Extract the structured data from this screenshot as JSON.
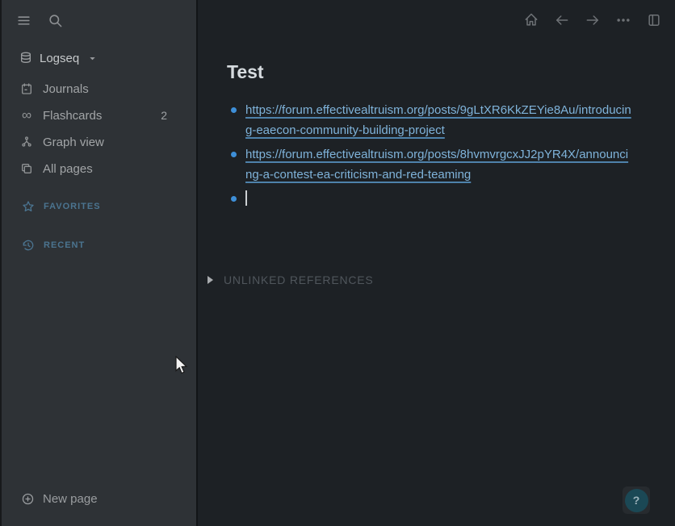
{
  "colors": {
    "main_bg": "#1d2125",
    "sidebar_bg": "#2e3236",
    "link": "#7fb3da",
    "bullet": "#3e8fd8",
    "section_accent": "#4b7490",
    "title": "#d6dbdf",
    "help_circle_bg": "#1b4855"
  },
  "sidebar": {
    "header_icons": [
      "hamburger-menu-icon",
      "search-icon"
    ],
    "graph_switcher": {
      "label": "Logseq",
      "icon": "database-icon",
      "caret": "chevron-down-icon"
    },
    "items": [
      {
        "label": "Journals",
        "icon": "calendar-icon"
      },
      {
        "label": "Flashcards",
        "icon": "infinity-icon",
        "badge": "2"
      },
      {
        "label": "Graph view",
        "icon": "graph-icon"
      },
      {
        "label": "All pages",
        "icon": "pages-icon"
      }
    ],
    "favorites": {
      "label": "FAVORITES",
      "icon": "star-icon"
    },
    "recent": {
      "label": "RECENT",
      "icon": "history-icon"
    },
    "new_page": {
      "label": "New page",
      "icon": "plus-circle-icon"
    }
  },
  "toolbar": {
    "icons": [
      "home-icon",
      "arrow-left-icon",
      "arrow-right-icon",
      "ellipsis-icon",
      "toggle-right-sidebar-icon"
    ]
  },
  "main": {
    "page_title": "Test",
    "blocks": [
      {
        "type": "link",
        "text": "https://forum.effectivealtruism.org/posts/9gLtXR6KkZEYie8Au/introducing-eaecon-community-building-project"
      },
      {
        "type": "link",
        "text": "https://forum.effectivealtruism.org/posts/8hvmvrgcxJJ2pYR4X/announcing-a-contest-ea-criticism-and-red-teaming"
      },
      {
        "type": "empty-editing",
        "text": ""
      }
    ],
    "unlinked_references": {
      "label": "UNLINKED REFERENCES",
      "collapsed": true
    }
  },
  "help": {
    "label": "?"
  }
}
